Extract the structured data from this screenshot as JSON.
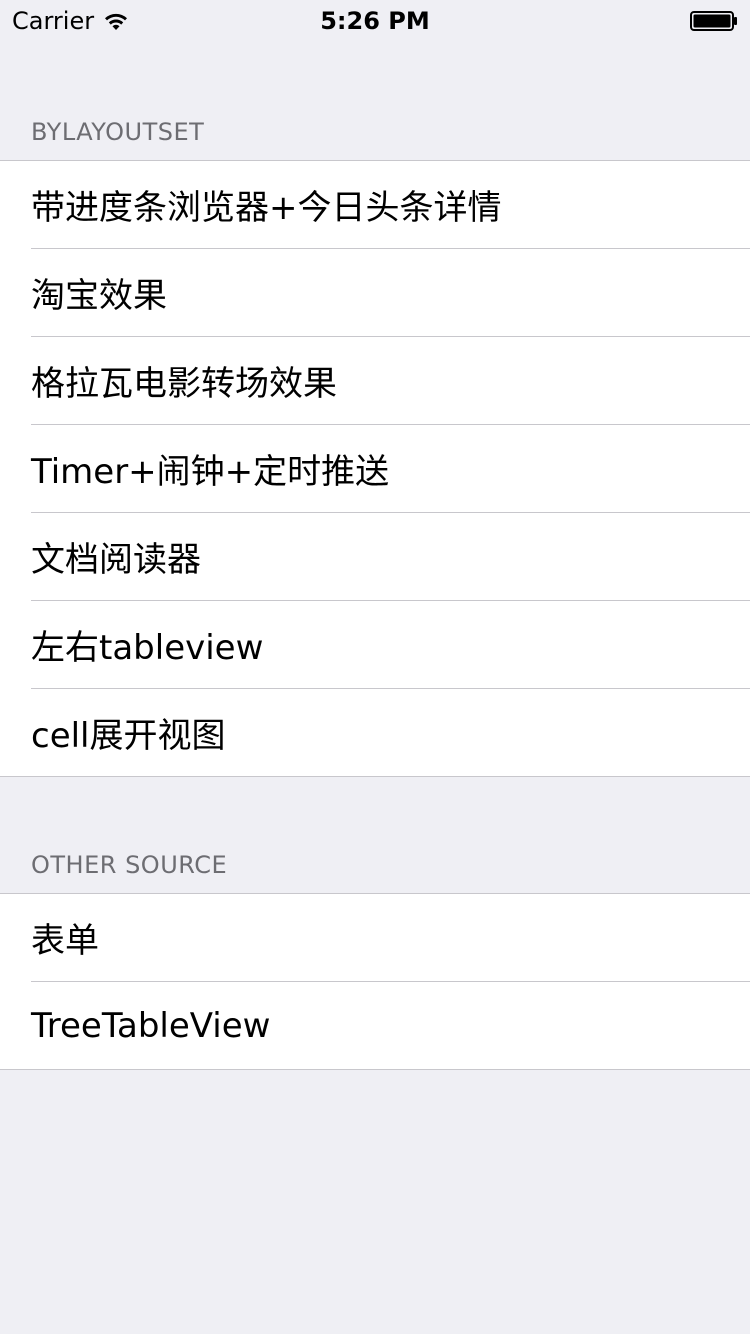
{
  "status_bar": {
    "carrier": "Carrier",
    "time": "5:26 PM",
    "wifi_icon": "wifi-icon",
    "battery_icon": "battery-icon"
  },
  "sections": [
    {
      "header": "BYLAYOUTSET",
      "items": [
        "带进度条浏览器+今日头条详情",
        "淘宝效果",
        "格拉瓦电影转场效果",
        "Timer+闹钟+定时推送",
        "文档阅读器",
        "左右tableview",
        "cell展开视图"
      ]
    },
    {
      "header": "OTHER SOURCE",
      "items": [
        "表单",
        "TreeTableView"
      ]
    }
  ],
  "colors": {
    "background": "#efeff4",
    "cell_background": "#ffffff",
    "separator": "#c8c7cc",
    "header_text": "#6d6d72"
  }
}
